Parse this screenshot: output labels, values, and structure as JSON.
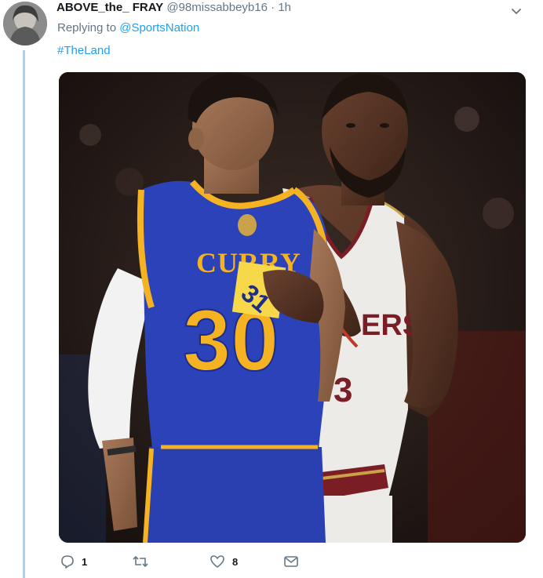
{
  "tweet": {
    "display_name": "ABOVE_the_ FRAY",
    "handle": "@98missabbeyb16",
    "separator": "·",
    "time": "1h",
    "replying_prefix": "Replying to",
    "replying_to": "@SportsNation",
    "hashtag": "#TheLand"
  },
  "media": {
    "jersey_front_name": "CURRY",
    "jersey_front_number": "30",
    "jersey_back_text": "ERS",
    "badge_number": "31"
  },
  "actions": {
    "reply_count": "1",
    "retweet_count": "",
    "like_count": "8"
  },
  "colors": {
    "link": "#1da1f2",
    "muted": "#657786",
    "thread_line": "#a7d4f2",
    "warriors_blue": "#2b42b8",
    "warriors_gold": "#f5b323"
  },
  "icons": [
    "chevron-down-icon",
    "reply-icon",
    "retweet-icon",
    "like-icon",
    "message-icon"
  ]
}
